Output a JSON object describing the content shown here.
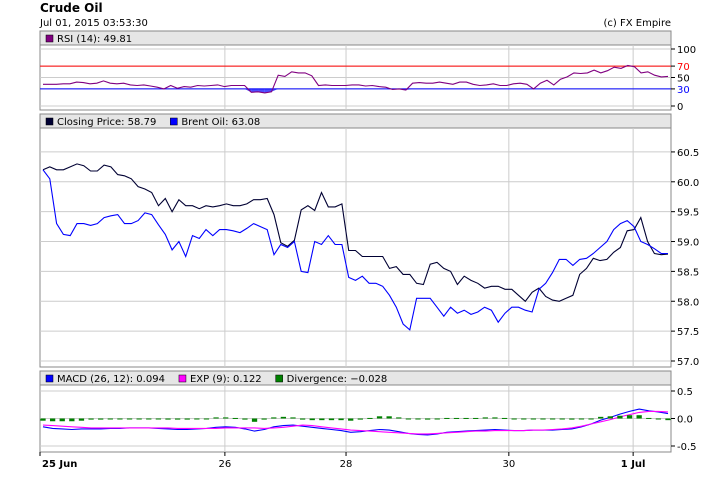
{
  "header": {
    "title": "Crude Oil",
    "timestamp": "Jul 01, 2015 03:53:30",
    "copyright": "(c) FX Empire"
  },
  "colors": {
    "closing": "#000033",
    "brent": "#0000ff",
    "rsi": "#800080",
    "rsi_upper": "#ff0000",
    "rsi_lower": "#0000ff",
    "macd": "#0000ff",
    "exp": "#ff00ff",
    "divergence": "#008000",
    "panel_header_bg": "#e6e6e6",
    "grid": "#cccccc"
  },
  "x_axis": {
    "ticks": [
      "25 Jun",
      "26",
      "28",
      "30",
      "1 Jul"
    ]
  },
  "chart_data": [
    {
      "type": "line",
      "panel": "RSI",
      "legend": [
        {
          "label": "RSI (14): 49.81",
          "color_key": "rsi"
        }
      ],
      "ylim": [
        0,
        100
      ],
      "yticks": [
        "100",
        "70",
        "50",
        "30",
        "0"
      ],
      "reference_lines": [
        {
          "value": 70,
          "label": "70",
          "color_key": "rsi_upper"
        },
        {
          "value": 30,
          "label": "30",
          "color_key": "rsi_lower"
        }
      ],
      "series": [
        {
          "name": "RSI (14)",
          "values": [
            38,
            38,
            38,
            39,
            39,
            42,
            41,
            39,
            40,
            44,
            40,
            39,
            40,
            37,
            36,
            37,
            35,
            33,
            30,
            36,
            31,
            34,
            33,
            36,
            35,
            36,
            37,
            34,
            36,
            36,
            36,
            24,
            25,
            23,
            25,
            54,
            52,
            60,
            58,
            58,
            53,
            36,
            37,
            36,
            36,
            36,
            37,
            37,
            35,
            36,
            34,
            33,
            29,
            30,
            28,
            40,
            41,
            40,
            40,
            42,
            40,
            38,
            42,
            42,
            38,
            36,
            37,
            39,
            36,
            36,
            39,
            40,
            38,
            30,
            40,
            45,
            37,
            47,
            51,
            58,
            57,
            58,
            63,
            58,
            62,
            68,
            66,
            71,
            69,
            58,
            60,
            54,
            51,
            52
          ]
        }
      ]
    },
    {
      "type": "line",
      "panel": "Price",
      "legend": [
        {
          "label": "Closing Price: 58.79",
          "color_key": "closing"
        },
        {
          "label": "Brent Oil: 63.08",
          "color_key": "brent"
        }
      ],
      "ylim": [
        57.0,
        60.8
      ],
      "yticks": [
        "60.5",
        "60.0",
        "59.5",
        "59.0",
        "58.5",
        "58.0",
        "57.5",
        "57.0"
      ],
      "series": [
        {
          "name": "Closing Price",
          "values": [
            60.2,
            60.25,
            60.2,
            60.2,
            60.25,
            60.3,
            60.27,
            60.18,
            60.18,
            60.28,
            60.25,
            60.12,
            60.1,
            60.05,
            59.92,
            59.88,
            59.82,
            59.6,
            59.72,
            59.5,
            59.7,
            59.6,
            59.6,
            59.55,
            59.6,
            59.58,
            59.6,
            59.63,
            59.6,
            59.6,
            59.63,
            59.7,
            59.7,
            59.72,
            59.45,
            58.98,
            58.92,
            59.02,
            59.53,
            59.6,
            59.52,
            59.82,
            59.58,
            59.58,
            59.63,
            58.85,
            58.85,
            58.75,
            58.75,
            58.75,
            58.75,
            58.55,
            58.58,
            58.45,
            58.45,
            58.3,
            58.28,
            58.62,
            58.65,
            58.55,
            58.5,
            58.28,
            58.42,
            58.35,
            58.3,
            58.22,
            58.25,
            58.25,
            58.2,
            58.2,
            58.1,
            58.0,
            58.15,
            58.22,
            58.08,
            58.02,
            58.0,
            58.05,
            58.1,
            58.45,
            58.55,
            58.72,
            58.68,
            58.7,
            58.82,
            58.9,
            59.18,
            59.2,
            59.4,
            59.0,
            58.8,
            58.78,
            58.79
          ]
        },
        {
          "name": "Brent Oil",
          "values": [
            60.2,
            60.05,
            59.3,
            59.12,
            59.1,
            59.3,
            59.3,
            59.27,
            59.3,
            59.4,
            59.43,
            59.45,
            59.3,
            59.3,
            59.35,
            59.48,
            59.45,
            59.28,
            59.12,
            58.86,
            59.0,
            58.75,
            59.1,
            59.05,
            59.2,
            59.1,
            59.2,
            59.2,
            59.18,
            59.15,
            59.22,
            59.3,
            59.25,
            59.2,
            58.78,
            58.95,
            58.9,
            59.0,
            58.5,
            58.48,
            59.0,
            58.95,
            59.1,
            58.95,
            58.95,
            58.4,
            58.35,
            58.42,
            58.3,
            58.3,
            58.25,
            58.1,
            57.9,
            57.62,
            57.52,
            58.05,
            58.05,
            58.05,
            57.9,
            57.75,
            57.9,
            57.8,
            57.85,
            57.78,
            57.82,
            57.9,
            57.85,
            57.65,
            57.8,
            57.9,
            57.9,
            57.85,
            57.82,
            58.2,
            58.3,
            58.48,
            58.7,
            58.7,
            58.6,
            58.7,
            58.72,
            58.8,
            58.9,
            59.0,
            59.2,
            59.3,
            59.35,
            59.25,
            59.0,
            58.95,
            58.88,
            58.8,
            58.8
          ]
        }
      ]
    },
    {
      "type": "line",
      "panel": "MACD",
      "legend": [
        {
          "label": "MACD (26, 12): 0.094",
          "color_key": "macd"
        },
        {
          "label": "EXP (9): 0.122",
          "color_key": "exp"
        },
        {
          "label": "Divergence: −0.028",
          "color_key": "divergence"
        }
      ],
      "ylim": [
        -0.5,
        0.5
      ],
      "yticks": [
        "0.5",
        "0.0",
        "-0.5"
      ],
      "series": [
        {
          "name": "MACD (26, 12)",
          "values": [
            -0.15,
            -0.18,
            -0.19,
            -0.2,
            -0.19,
            -0.19,
            -0.19,
            -0.18,
            -0.18,
            -0.17,
            -0.17,
            -0.17,
            -0.18,
            -0.19,
            -0.2,
            -0.2,
            -0.19,
            -0.18,
            -0.16,
            -0.15,
            -0.16,
            -0.19,
            -0.23,
            -0.2,
            -0.15,
            -0.13,
            -0.12,
            -0.14,
            -0.16,
            -0.18,
            -0.2,
            -0.22,
            -0.25,
            -0.24,
            -0.22,
            -0.2,
            -0.21,
            -0.24,
            -0.27,
            -0.29,
            -0.3,
            -0.28,
            -0.25,
            -0.24,
            -0.23,
            -0.22,
            -0.21,
            -0.2,
            -0.21,
            -0.22,
            -0.22,
            -0.21,
            -0.21,
            -0.21,
            -0.2,
            -0.19,
            -0.15,
            -0.1,
            -0.03,
            0.02,
            0.08,
            0.13,
            0.17,
            0.14,
            0.12,
            0.09
          ]
        },
        {
          "name": "EXP (9)",
          "values": [
            -0.12,
            -0.13,
            -0.14,
            -0.15,
            -0.16,
            -0.17,
            -0.17,
            -0.17,
            -0.17,
            -0.17,
            -0.17,
            -0.17,
            -0.17,
            -0.17,
            -0.18,
            -0.18,
            -0.18,
            -0.18,
            -0.18,
            -0.17,
            -0.17,
            -0.17,
            -0.17,
            -0.18,
            -0.17,
            -0.16,
            -0.14,
            -0.12,
            -0.13,
            -0.15,
            -0.17,
            -0.19,
            -0.21,
            -0.22,
            -0.23,
            -0.24,
            -0.25,
            -0.26,
            -0.27,
            -0.28,
            -0.28,
            -0.27,
            -0.26,
            -0.25,
            -0.24,
            -0.23,
            -0.23,
            -0.22,
            -0.22,
            -0.22,
            -0.22,
            -0.21,
            -0.21,
            -0.2,
            -0.19,
            -0.17,
            -0.14,
            -0.1,
            -0.06,
            -0.02,
            0.03,
            0.07,
            0.11,
            0.13,
            0.13,
            0.12
          ]
        },
        {
          "name": "Divergence",
          "style": "bars",
          "values": [
            -0.04,
            -0.05,
            -0.05,
            -0.05,
            -0.04,
            -0.02,
            -0.02,
            -0.01,
            -0.01,
            0.0,
            0.0,
            0.0,
            -0.01,
            -0.02,
            -0.02,
            -0.02,
            -0.01,
            0.0,
            0.02,
            0.02,
            0.01,
            -0.02,
            -0.06,
            -0.02,
            0.02,
            0.03,
            0.02,
            -0.02,
            -0.03,
            -0.03,
            -0.03,
            -0.03,
            -0.04,
            -0.02,
            0.01,
            0.04,
            0.04,
            0.02,
            0.0,
            -0.01,
            -0.02,
            -0.01,
            0.01,
            0.01,
            0.01,
            0.01,
            0.02,
            0.02,
            0.01,
            0.0,
            0.0,
            0.0,
            0.0,
            -0.01,
            -0.01,
            -0.02,
            -0.01,
            0.0,
            0.03,
            0.04,
            0.05,
            0.06,
            0.06,
            0.01,
            -0.01,
            -0.03
          ]
        }
      ]
    }
  ]
}
